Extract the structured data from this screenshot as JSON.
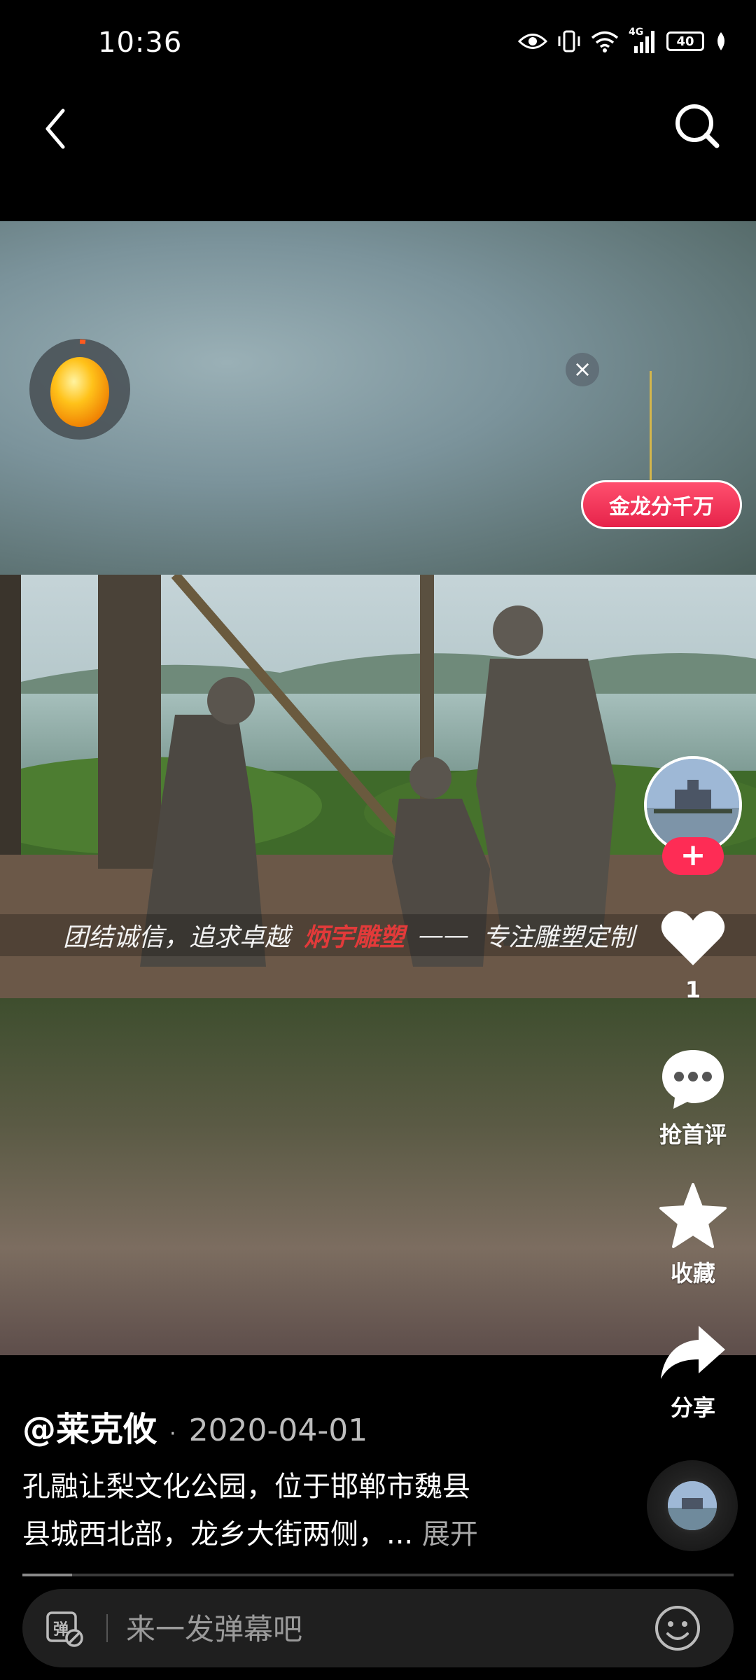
{
  "status": {
    "time": "10:36",
    "network": "4G",
    "battery": "40"
  },
  "promo": {
    "badge_label": "金龙分千万",
    "close_symbol": "×"
  },
  "video": {
    "watermark_left": "团结诚信，追求卓越",
    "watermark_brand": "炳宇雕塑",
    "watermark_dash": "——",
    "watermark_right": "专注雕塑定制"
  },
  "rail": {
    "follow_symbol": "+",
    "like_count": "1",
    "comment_label": "抢首评",
    "favorite_label": "收藏",
    "share_label": "分享"
  },
  "post": {
    "author": "@莱克攸",
    "separator": "·",
    "date": "2020-04-01",
    "description_line1": "孔融让梨文化公园，位于邯郸市魏县",
    "description_line2": "县城西北部，龙乡大街两侧，...",
    "expand_label": "展开"
  },
  "progress": {
    "fraction": 0.07
  },
  "comment_bar": {
    "danmaku_icon_text": "弹",
    "placeholder": "来一发弹幕吧"
  },
  "colors": {
    "accent": "#fe2c55",
    "promo": "#e6234a"
  }
}
